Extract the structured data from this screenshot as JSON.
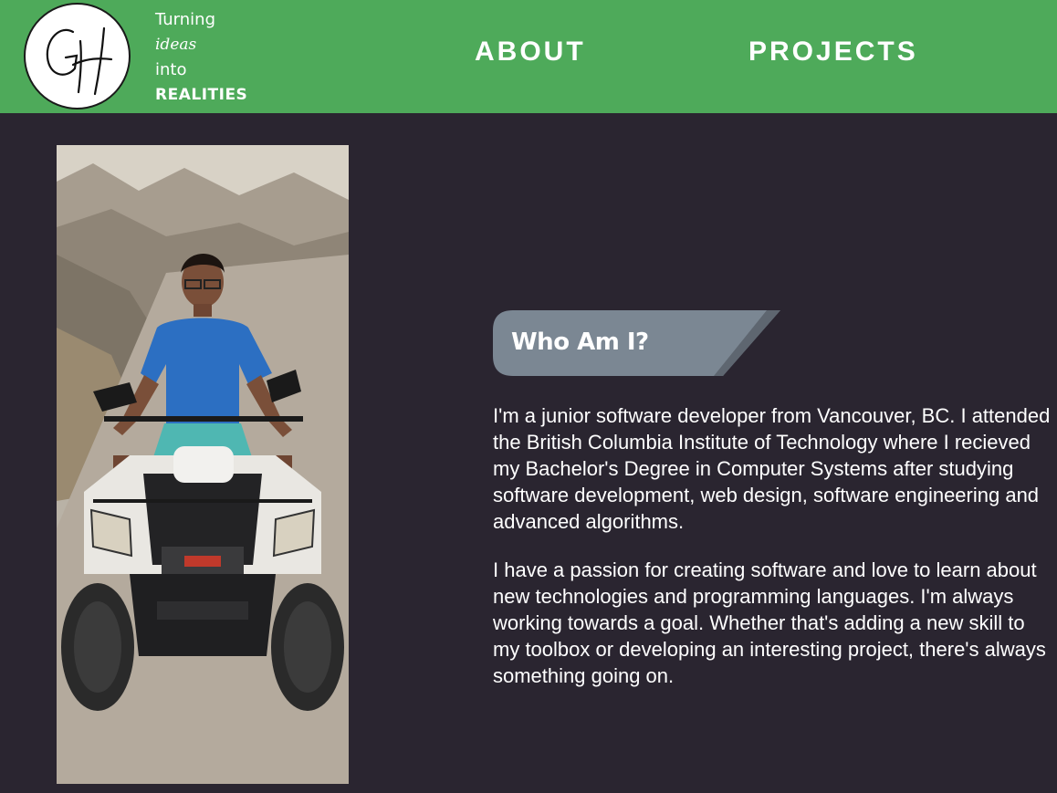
{
  "header": {
    "logo_letters": "GH",
    "tagline": [
      "Turning",
      "ideas",
      "into",
      "REALITIES"
    ],
    "nav": [
      {
        "label": "ABOUT"
      },
      {
        "label": "PROJECTS"
      }
    ]
  },
  "about": {
    "heading": "Who Am I?",
    "paragraphs": [
      "I'm a junior software developer from Vancouver, BC. I attended the British Columbia Institute of Technology where I recieved my Bachelor's Degree in Computer Systems after studying software development, web design, software engineering and advanced algorithms.",
      "I have a passion for creating software and love to learn about new technologies and programming languages. I'm always working towards a goal. Whether that's adding a new skill to my toolbox or developing an interesting project, there's always something going on."
    ]
  },
  "colors": {
    "header_bg": "#4eaa5a",
    "page_bg": "#2a2530",
    "heading_tab": "#7b8793",
    "text": "#ffffff"
  }
}
